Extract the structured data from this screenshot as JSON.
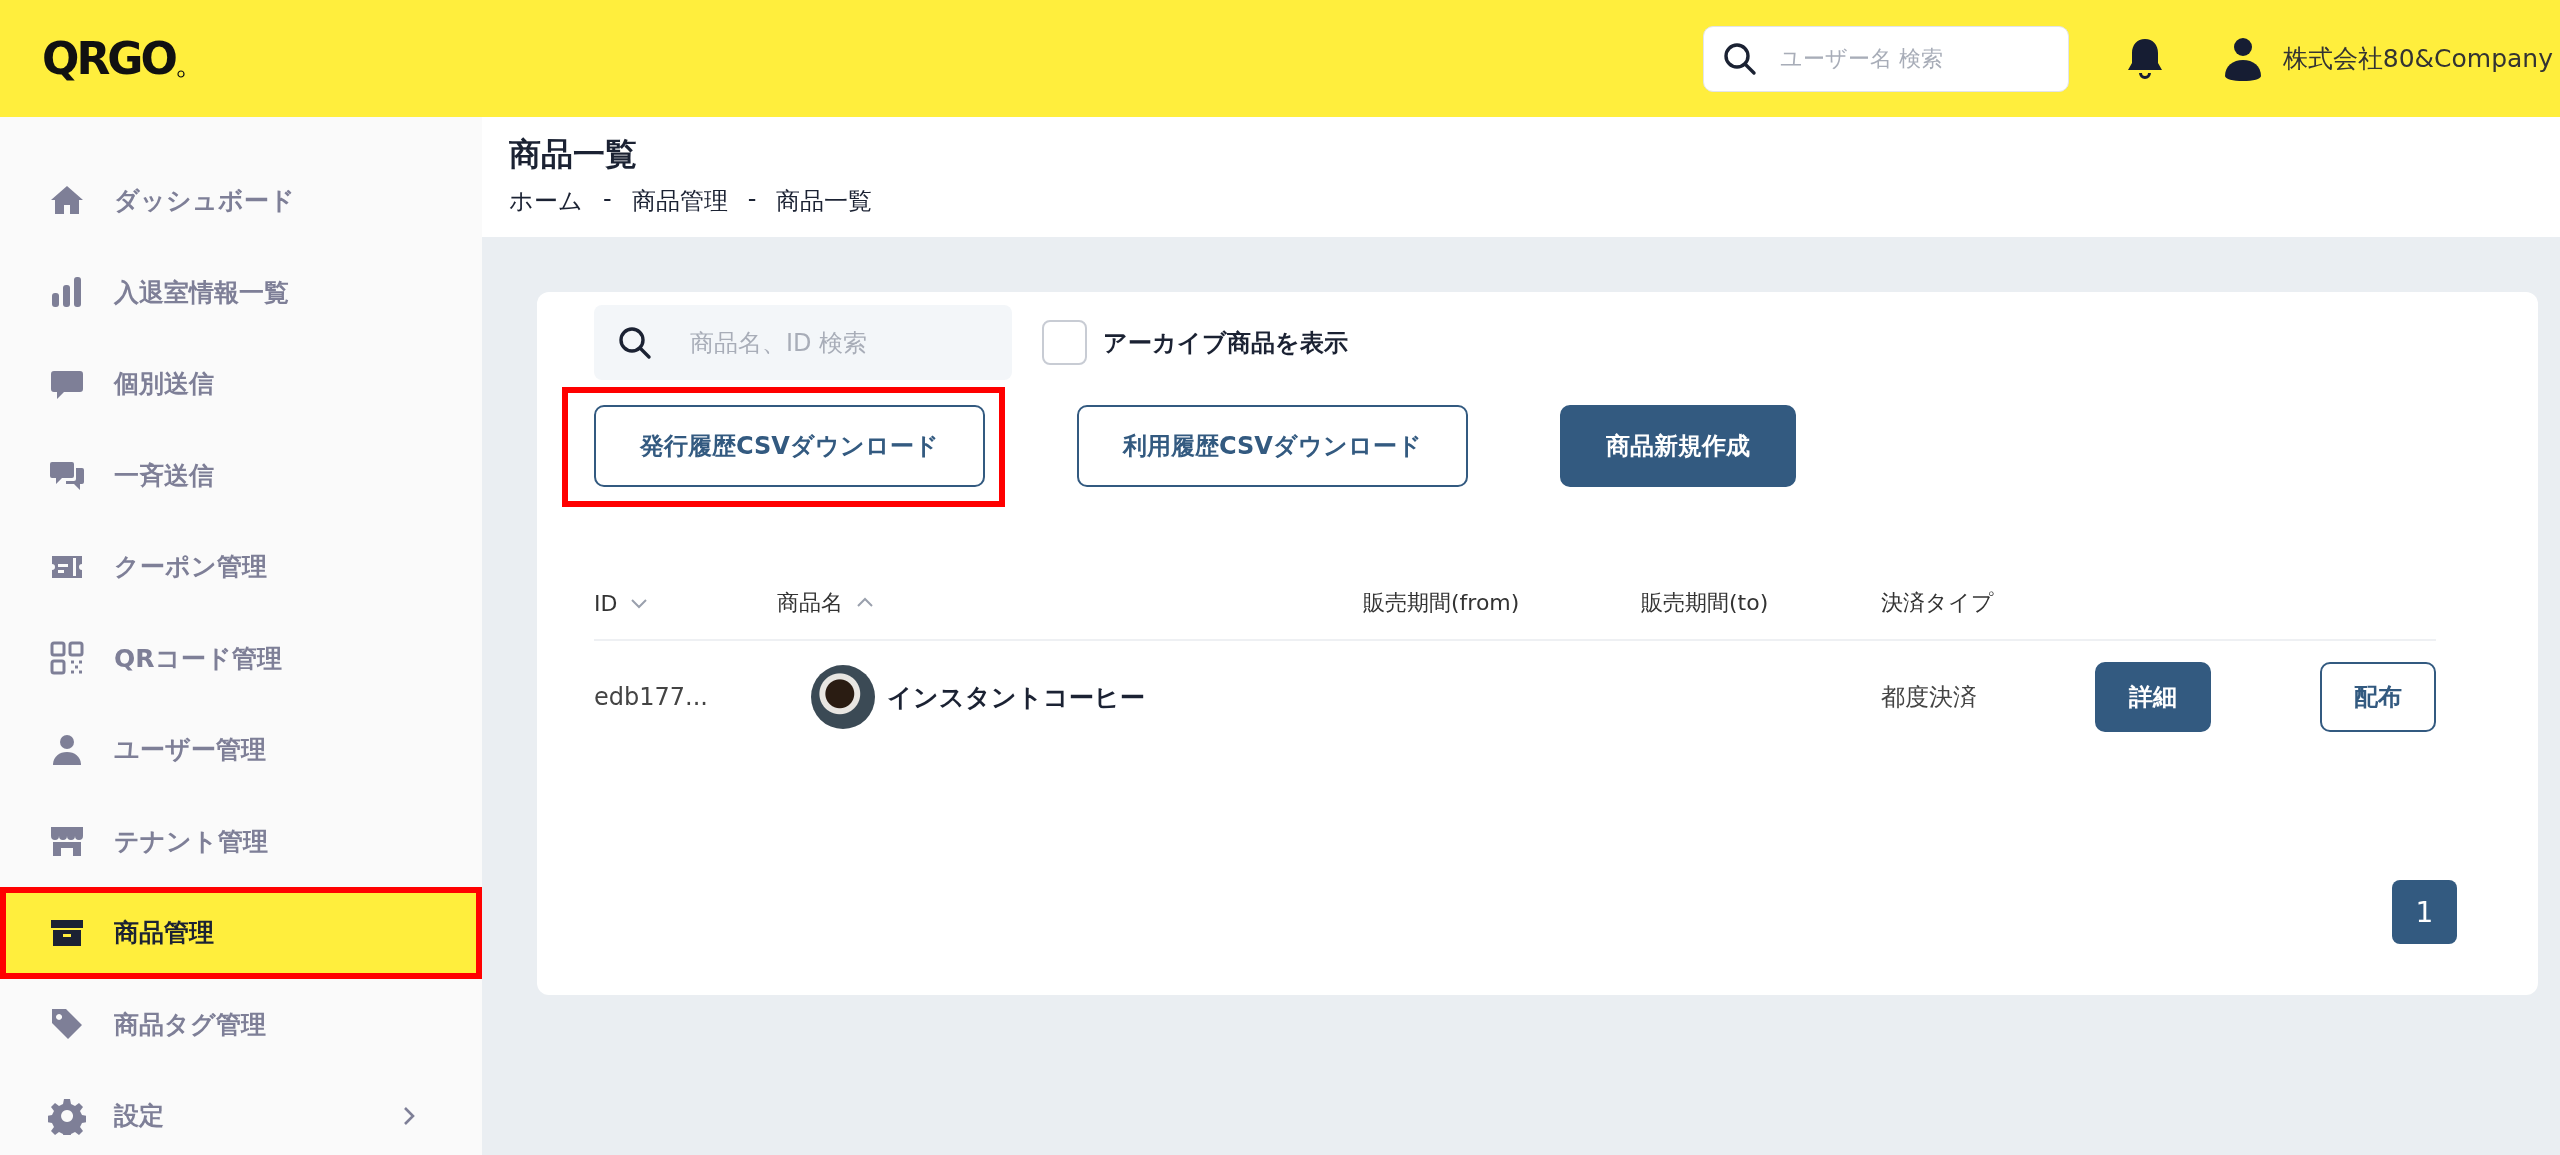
{
  "header": {
    "logo": "QRGO",
    "search": {
      "placeholder": "ユーザー名 検索"
    },
    "user_name": "株式会社80&Company"
  },
  "sidebar": {
    "items": [
      {
        "label": "ダッシュボード",
        "selected": false,
        "highlighted": false,
        "has_submenu": false
      },
      {
        "label": "入退室情報一覧",
        "selected": false,
        "highlighted": false,
        "has_submenu": false
      },
      {
        "label": "個別送信",
        "selected": false,
        "highlighted": false,
        "has_submenu": false
      },
      {
        "label": "一斉送信",
        "selected": false,
        "highlighted": false,
        "has_submenu": false
      },
      {
        "label": "クーポン管理",
        "selected": false,
        "highlighted": false,
        "has_submenu": false
      },
      {
        "label": "QRコード管理",
        "selected": false,
        "highlighted": false,
        "has_submenu": false
      },
      {
        "label": "ユーザー管理",
        "selected": false,
        "highlighted": false,
        "has_submenu": false
      },
      {
        "label": "テナント管理",
        "selected": false,
        "highlighted": false,
        "has_submenu": false
      },
      {
        "label": "商品管理",
        "selected": true,
        "highlighted": true,
        "has_submenu": false
      },
      {
        "label": "商品タグ管理",
        "selected": false,
        "highlighted": false,
        "has_submenu": false
      },
      {
        "label": "設定",
        "selected": false,
        "highlighted": false,
        "has_submenu": true
      }
    ]
  },
  "page": {
    "title": "商品一覧",
    "breadcrumb": [
      "ホーム",
      "-",
      "商品管理",
      "-",
      "商品一覧"
    ]
  },
  "toolbar": {
    "search": {
      "placeholder": "商品名、ID 検索"
    },
    "archive_toggle": {
      "label": "アーカイブ商品を表示",
      "checked": false
    },
    "buttons": [
      {
        "label": "発行履歴CSVダウンロード",
        "kind": "outline",
        "highlighted": true
      },
      {
        "label": "利用履歴CSVダウンロード",
        "kind": "outline",
        "highlighted": false
      },
      {
        "label": "商品新規作成",
        "kind": "primary",
        "highlighted": false
      }
    ]
  },
  "table": {
    "columns": [
      {
        "label": "ID",
        "kind": "sort_desc"
      },
      {
        "label": "商品名",
        "kind": "sort_asc"
      },
      {
        "label": "販売期間(from)",
        "kind": "plain"
      },
      {
        "label": "販売期間(to)",
        "kind": "plain"
      },
      {
        "label": "決済タイプ",
        "kind": "plain"
      }
    ],
    "rows": [
      {
        "id": "edb177...",
        "name": "インスタントコーヒー",
        "payment_type": "都度決済",
        "actions": [
          {
            "label": "詳細",
            "kind": "primary"
          },
          {
            "label": "配布",
            "kind": "outline"
          }
        ]
      }
    ]
  },
  "pagination": [
    {
      "label": "1",
      "selected": true
    }
  ]
}
